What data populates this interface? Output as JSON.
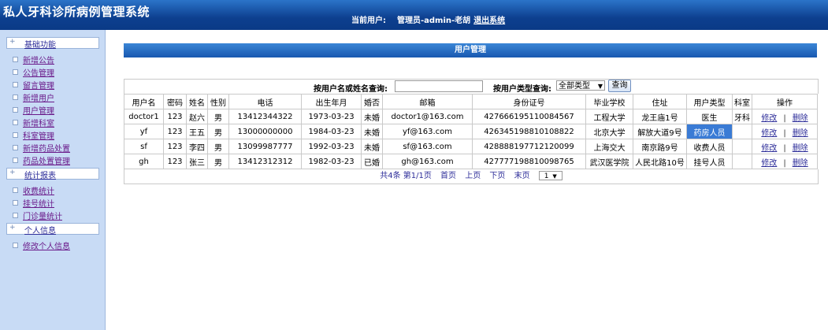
{
  "header": {
    "app_title": "私人牙科诊所病例管理系统",
    "user_label": "当前用户:",
    "user_value": "管理员-admin-老胡",
    "logout": "退出系统"
  },
  "sidebar": {
    "sections": [
      {
        "title": "基础功能",
        "items": [
          "新增公告",
          "公告管理",
          "留言管理",
          "新增用户",
          "用户管理",
          "新增科室",
          "科室管理",
          "新增药品处置",
          "药品处置管理"
        ]
      },
      {
        "title": "统计报表",
        "items": [
          "收费统计",
          "挂号统计",
          "门诊量统计"
        ]
      },
      {
        "title": "个人信息",
        "items": [
          "修改个人信息"
        ]
      }
    ]
  },
  "main": {
    "banner": "用户管理",
    "search": {
      "name_label": "按用户名或姓名查询:",
      "name_value": "",
      "type_label": "按用户类型查询:",
      "type_value": "全部类型",
      "button": "查询"
    },
    "table": {
      "headers": [
        "用户名",
        "密码",
        "姓名",
        "性别",
        "电话",
        "出生年月",
        "婚否",
        "邮箱",
        "身份证号",
        "毕业学校",
        "住址",
        "用户类型",
        "科室",
        "操作"
      ],
      "rows": [
        [
          "doctor1",
          "123",
          "赵六",
          "男",
          "13412344322",
          "1973-03-23",
          "未婚",
          "doctor1@163.com",
          "427666195110084567",
          "工程大学",
          "龙王庙1号",
          "医生",
          "牙科"
        ],
        [
          "yf",
          "123",
          "王五",
          "男",
          "13000000000",
          "1984-03-23",
          "未婚",
          "yf@163.com",
          "426345198810108822",
          "北京大学",
          "解放大道9号",
          "药房人员",
          ""
        ],
        [
          "sf",
          "123",
          "李四",
          "男",
          "13099987777",
          "1992-03-23",
          "未婚",
          "sf@163.com",
          "428888197712120099",
          "上海交大",
          "南京路9号",
          "收费人员",
          ""
        ],
        [
          "gh",
          "123",
          "张三",
          "男",
          "13412312312",
          "1982-03-23",
          "已婚",
          "gh@163.com",
          "427777198810098765",
          "武汉医学院",
          "人民北路10号",
          "挂号人员",
          ""
        ]
      ],
      "edit_label": "修改",
      "delete_label": "删除"
    },
    "pager": {
      "summary": "共4条 第1/1页",
      "first": "首页",
      "prev": "上页",
      "next": "下页",
      "last": "末页",
      "page_value": "1"
    }
  }
}
